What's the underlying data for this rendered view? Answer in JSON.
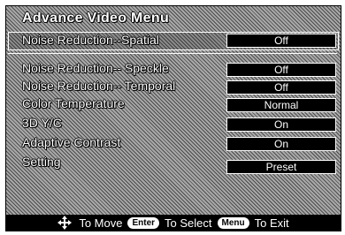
{
  "menu": {
    "title": "Advance Video Menu",
    "items": [
      {
        "label": "Noise Reduction--Spatial",
        "value": "Off"
      },
      {
        "label": "Noise Reduction-- Speckle",
        "value": "Off"
      },
      {
        "label": "Noise Reduction-- Temporal",
        "value": "Off"
      },
      {
        "label": "Color Temperature",
        "value": "Normal"
      },
      {
        "label": "3D Y/C",
        "value": "On"
      },
      {
        "label": "Adaptive Contrast",
        "value": "On"
      },
      {
        "label": "Setting",
        "value": "Preset"
      }
    ]
  },
  "footer": {
    "move_label": "To Move",
    "enter_key": "Enter",
    "select_label": "To Select",
    "menu_key": "Menu",
    "exit_label": "To Exit"
  },
  "icons": {
    "move": "four-way-arrow-icon"
  }
}
